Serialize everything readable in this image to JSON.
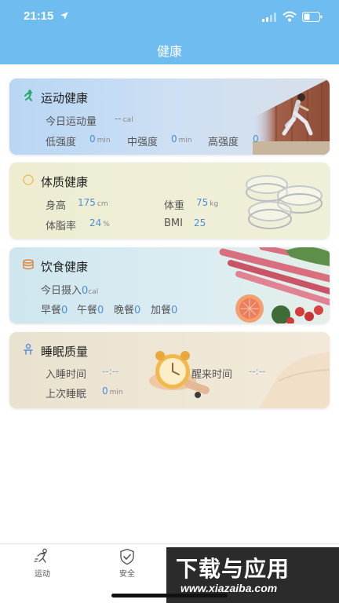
{
  "status_bar": {
    "time": "21:15"
  },
  "header": {
    "title": "健康"
  },
  "cards": {
    "sport": {
      "title": "运动健康",
      "today_label": "今日运动量",
      "today_value": "--",
      "today_unit": "cal",
      "low_label": "低强度",
      "low_value": "0",
      "low_unit": "min",
      "mid_label": "中强度",
      "mid_value": "0",
      "mid_unit": "min",
      "high_label": "高强度",
      "high_value": "0"
    },
    "body": {
      "title": "体质健康",
      "height_label": "身高",
      "height_value": "175",
      "height_unit": "cm",
      "weight_label": "体重",
      "weight_value": "75",
      "weight_unit": "kg",
      "fat_label": "体脂率",
      "fat_value": "24",
      "fat_unit": "%",
      "bmi_label": "BMI",
      "bmi_value": "25"
    },
    "diet": {
      "title": "饮食健康",
      "intake_label": "今日摄入",
      "intake_value": "0",
      "intake_unit": "cal",
      "breakfast_label": "早餐",
      "breakfast_value": "0",
      "lunch_label": "午餐",
      "lunch_value": "0",
      "dinner_label": "晚餐",
      "dinner_value": "0",
      "extra_label": "加餐",
      "extra_value": "0"
    },
    "sleep": {
      "title": "睡眠质量",
      "bedtime_label": "入睡时间",
      "bedtime_value": "--:--",
      "wake_label": "醒来时间",
      "wake_value": "--:--",
      "last_label": "上次睡眠",
      "last_value": "0",
      "last_unit": "min"
    }
  },
  "tabbar": {
    "tabs": [
      {
        "label": "运动",
        "icon": "running-icon"
      },
      {
        "label": "安全",
        "icon": "shield-check-icon"
      }
    ]
  },
  "watermark": {
    "main": "下载与应用",
    "url": "www.xiazaiba.com"
  },
  "colors": {
    "header": "#6fbdf0",
    "value_blue": "#4a8fd8",
    "accent_green": "#2aa86a",
    "accent_orange": "#e0853a"
  }
}
